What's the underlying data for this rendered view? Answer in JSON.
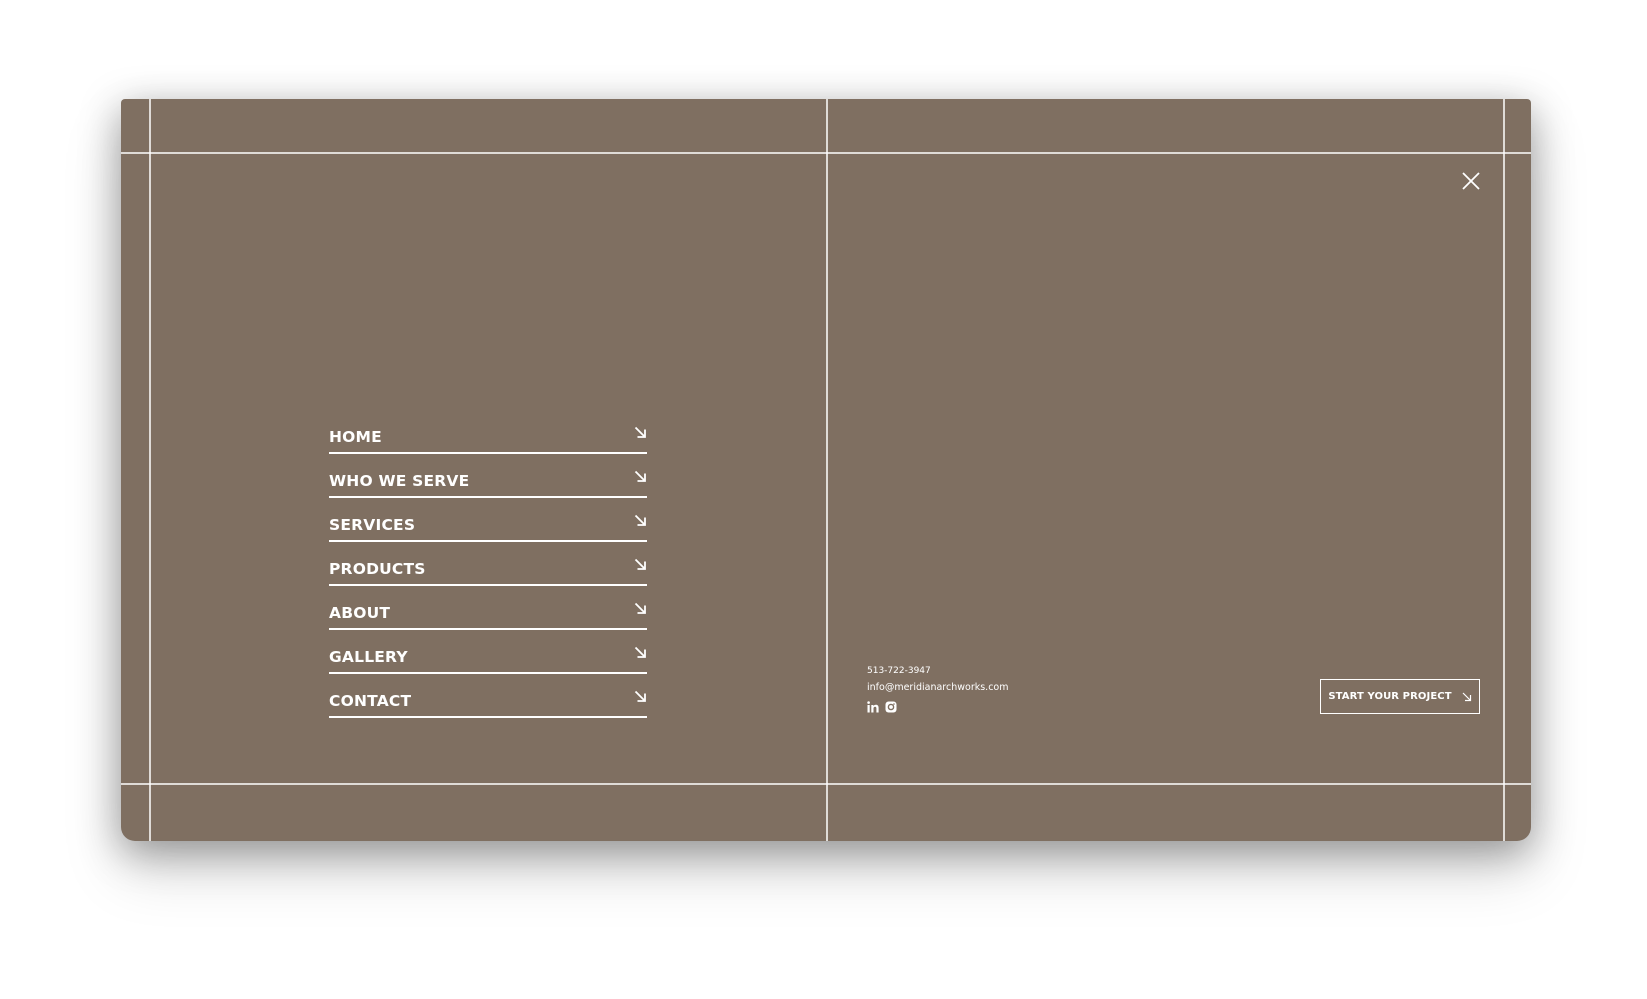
{
  "menu": {
    "items": [
      {
        "label": "HOME"
      },
      {
        "label": "WHO WE SERVE"
      },
      {
        "label": "SERVICES"
      },
      {
        "label": "PRODUCTS"
      },
      {
        "label": "ABOUT"
      },
      {
        "label": "GALLERY"
      },
      {
        "label": "CONTACT"
      }
    ],
    "arrow_icon": "arrow-down-right-icon",
    "close_icon": "close-icon"
  },
  "contact": {
    "phone": "513-722-3947",
    "email": "info@meridianarchworks.com",
    "social": [
      {
        "icon": "linkedin-icon"
      },
      {
        "icon": "instagram-icon"
      }
    ]
  },
  "cta": {
    "label": "START YOUR PROJECT",
    "icon": "arrow-down-right-icon"
  },
  "colors": {
    "background": "#7f6f61",
    "foreground": "#ffffff"
  }
}
